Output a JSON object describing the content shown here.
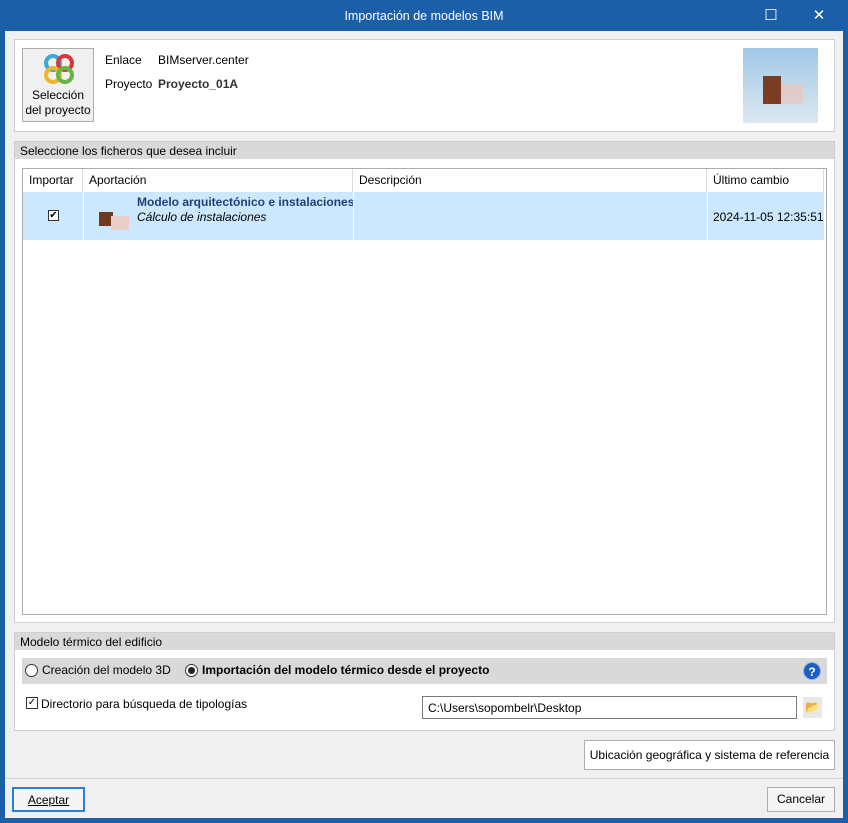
{
  "window": {
    "title": "Importación de modelos BIM",
    "maximize_icon": "maximize-icon",
    "close_icon": "close-icon"
  },
  "project": {
    "select_button": "Selección del proyecto",
    "select_line1": "Selección",
    "select_line2": "del proyecto",
    "link_label": "Enlace",
    "link_value": "BIMserver.center",
    "project_label": "Proyecto",
    "project_value": "Proyecto_01A"
  },
  "files": {
    "section_title": "Seleccione los ficheros que desea incluir",
    "columns": [
      "Importar",
      "Aportación",
      "Descripción",
      "Último cambio"
    ],
    "rows": [
      {
        "checked": true,
        "title": "Modelo arquitectónico e instalaciones",
        "subtitle": "Cálculo de instalaciones",
        "description": "",
        "changed": "2024-11-05 12:35:51"
      }
    ]
  },
  "thermal": {
    "section_title": "Modelo térmico del edificio",
    "option_create": "Creación del modelo 3D",
    "option_import": "Importación del modelo térmico desde el proyecto",
    "selected": "import",
    "dir_label": "Directorio para búsqueda de tipologías",
    "dir_checked": true,
    "dir_value": "C:\\Users\\sopombelr\\Desktop"
  },
  "buttons": {
    "geo": "Ubicación geográfica y sistema de referencia",
    "accept": "Aceptar",
    "cancel": "Cancelar"
  },
  "colors": {
    "titlebar": "#1a5fa8",
    "selection": "#cce8ff",
    "link_text": "#1f3f7a"
  }
}
